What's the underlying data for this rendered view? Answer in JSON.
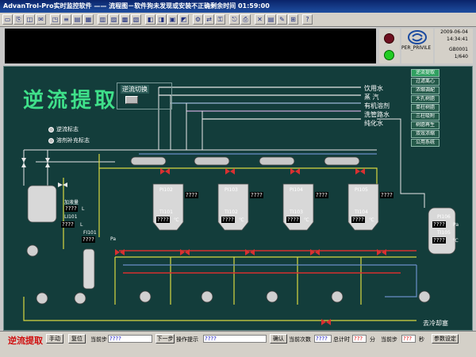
{
  "window": {
    "title": "AdvanTrol-Pro实时监控软件 —— 流程图－软件狗未发现或安装不正确剩余时间 01:59:00"
  },
  "toolbar": {
    "icons": [
      "new-icon",
      "open-icon",
      "graph-icon",
      "alarm-icon",
      "trend-icon",
      "list-icon",
      "group-icon",
      "overview-icon",
      "bar-icon",
      "doc-icon",
      "print-icon",
      "tag-icon",
      "config-icon",
      "pause-icon",
      "help-icon",
      "user-icon",
      "lock-icon",
      "switch-icon",
      "key-icon",
      "exit-icon",
      "info-icon",
      "about-icon"
    ]
  },
  "info": {
    "date": "2009-06-04",
    "time": "14:34:41",
    "user": "PER_PRIVILE",
    "station": "GB0001",
    "page": "1/640"
  },
  "indicators": {
    "top_color": "#6e1020",
    "bottom_color": "#22cc22"
  },
  "colors": {
    "bg": "#133d3b",
    "pipe_white": "#e8e8e8",
    "pipe_yellow": "#d8d840",
    "pipe_blue": "#6a90c8",
    "pipe_red": "#d83030",
    "title_green": "#3fe08a"
  },
  "main": {
    "title": "逆流提取",
    "switch_label": "逆流切换",
    "legend": [
      "饮用水",
      "蒸  汽",
      "有机溶剂",
      "洗管路水",
      "纯化水"
    ],
    "status": [
      "逆流标志",
      "溶剂补充标志"
    ],
    "menu": [
      "逆流提取",
      "过滤离心",
      "浓缩调配",
      "大孔树脂",
      "单柱树脂",
      "三柱吸附",
      "树脂再生",
      "双效浓缩",
      "公用系统"
    ],
    "tank_labels": {
      "add_amount": "加液量",
      "add_val": "????",
      "add_unit": "L",
      "li101": "LI101",
      "li101_val": "????",
      "li101_unit": "L",
      "fi101": "FI101",
      "fi101_val": "????",
      "pressure": "Pa",
      "pi106": "PI106",
      "pi106_val": "????",
      "pi106_unit": "Pa",
      "ti105": "TI105",
      "ti105_val": "????",
      "ti105_unit": "℃"
    },
    "extractors": [
      {
        "pi": "PI102",
        "pi_val": "????",
        "ti": "TI101",
        "ti_val": "????",
        "unit": "℃"
      },
      {
        "pi": "PI103",
        "pi_val": "????",
        "ti": "TI102",
        "ti_val": "????",
        "unit": "℃"
      },
      {
        "pi": "PI104",
        "pi_val": "????",
        "ti": "TI103",
        "ti_val": "????",
        "unit": "℃"
      },
      {
        "pi": "PI105",
        "pi_val": "????",
        "ti": "TI104",
        "ti_val": "????",
        "unit": "℃"
      }
    ],
    "cooling_water": "去冷却塞"
  },
  "bottom": {
    "title": "逆流提取",
    "manual": "手动",
    "reset": "复位",
    "current_step_label": "当前步",
    "current_step": "????",
    "next_step": "下一步",
    "op_hint_label": "操作提示",
    "op_hint": "????",
    "confirm": "确认",
    "current_count_label": "当前次数",
    "current_count": "????",
    "total_time_label": "总计时",
    "total_time": "???",
    "minute": "分",
    "current_step2_label": "当前步",
    "current_step2": "???",
    "second": "秒",
    "param_set": "参数设定"
  }
}
